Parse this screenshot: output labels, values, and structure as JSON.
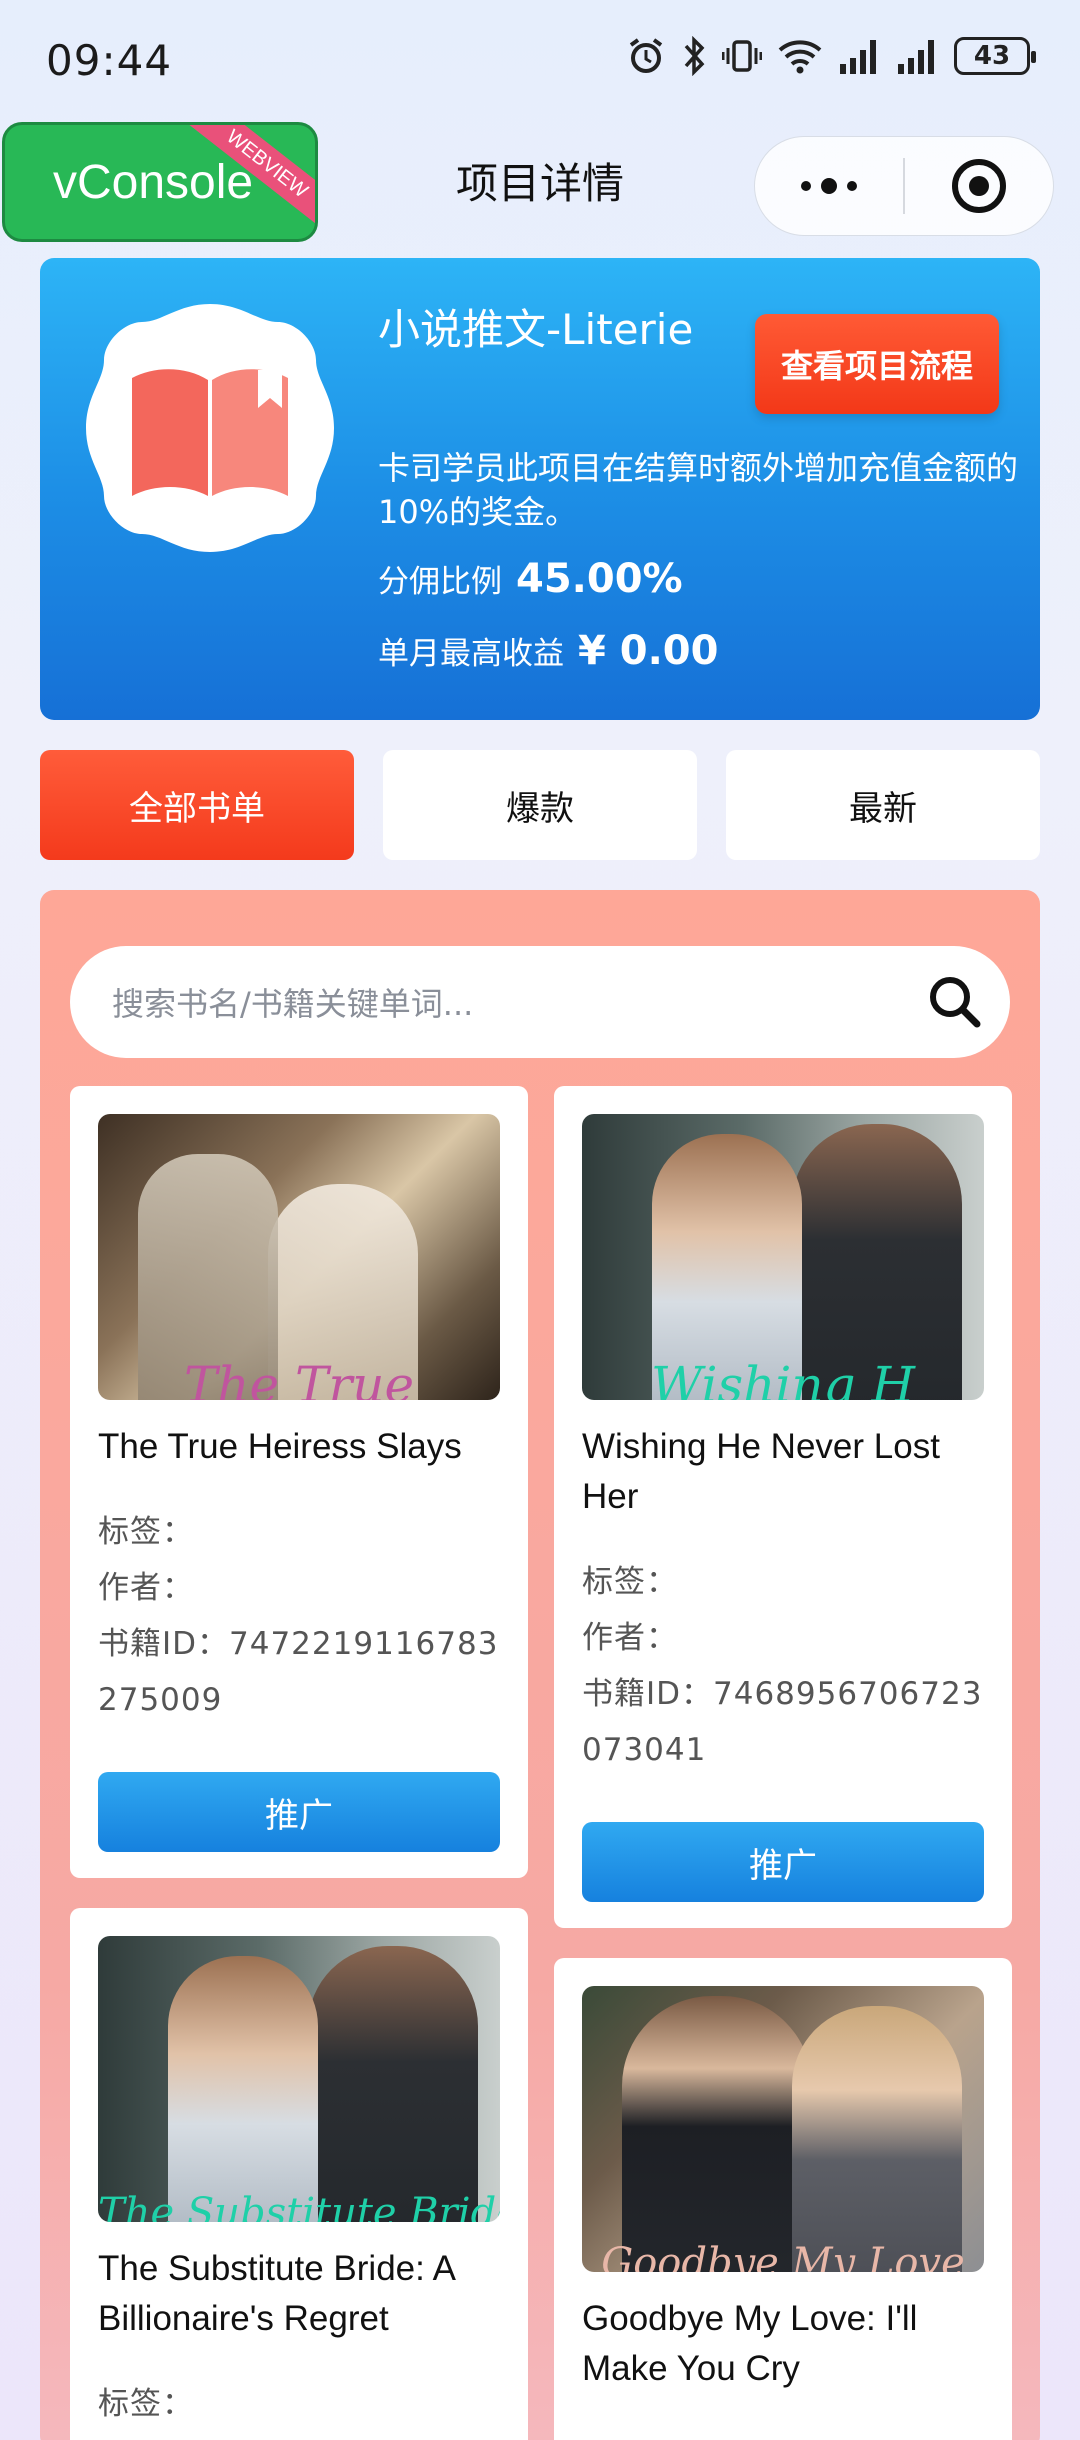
{
  "status_bar": {
    "time": "09:44",
    "battery": "43",
    "icons": [
      "alarm-icon",
      "bluetooth-icon",
      "vibrate-icon",
      "wifi-icon",
      "signal-icon",
      "signal-icon",
      "battery-icon"
    ]
  },
  "nav": {
    "vconsole_label": "vConsole",
    "vconsole_ribbon": "WEBVIEW",
    "title": "项目详情"
  },
  "project": {
    "title": "小说推文-Literie",
    "flow_button": "查看项目流程",
    "description": "卡司学员此项目在结算时额外增加充值金额的10%的奖金。",
    "commission_label": "分佣比例",
    "commission_value": "45.00%",
    "max_income_label": "单月最高收益",
    "max_income_value": "¥ 0.00"
  },
  "tabs": [
    {
      "label": "全部书单",
      "active": true
    },
    {
      "label": "爆款",
      "active": false
    },
    {
      "label": "最新",
      "active": false
    }
  ],
  "search": {
    "placeholder": "搜索书名/书籍关键单词..."
  },
  "books": [
    {
      "cover_text": "The True",
      "title": "The True Heiress Slays",
      "tag_label": "标签：",
      "author_label": "作者：",
      "id_label": "书籍ID：",
      "id": "7472219116783275009",
      "button": "推广"
    },
    {
      "cover_text": "Wishing H",
      "title": "Wishing He Never Lost Her",
      "tag_label": "标签：",
      "author_label": "作者：",
      "id_label": "书籍ID：",
      "id": "7468956706723073041",
      "button": "推广"
    },
    {
      "cover_text": "The Substitute Bride",
      "title": "The Substitute Bride: A Billionaire's Regret",
      "tag_label": "标签："
    },
    {
      "cover_text": "Goodbye My Love",
      "title": "Goodbye My Love: I'll Make You Cry"
    }
  ],
  "colors": {
    "accent_red": "#f43a1c",
    "accent_blue": "#1d8fe6",
    "panel_pink": "#f8a9a0",
    "vconsole_green": "#28b856"
  }
}
